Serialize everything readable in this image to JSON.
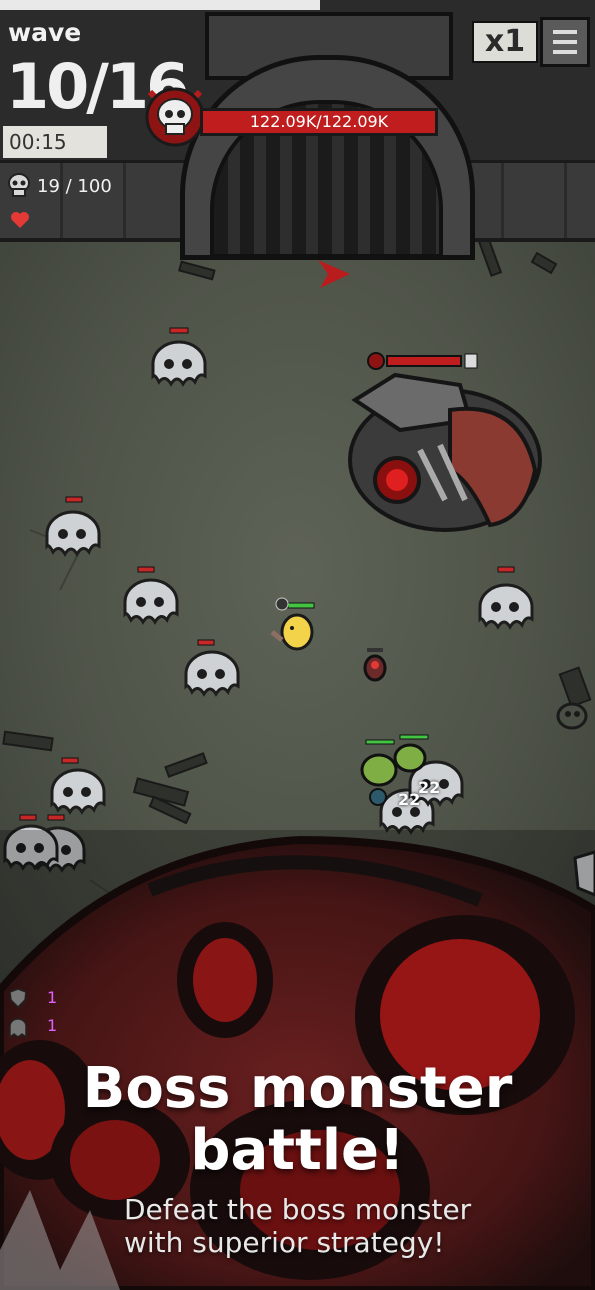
{
  "hud": {
    "wave_label": "wave",
    "wave_value": "10/16",
    "timer": "00:15",
    "kill_count": "19 / 100",
    "speed_label": "x1"
  },
  "boss": {
    "hp_text": "122.09K/122.09K",
    "hp_fraction": 1.0
  },
  "skills": [
    {
      "icon": "shield-icon",
      "count": "1"
    },
    {
      "icon": "ghost-icon",
      "count": "1"
    }
  ],
  "damage_numbers": [
    "22",
    "22"
  ],
  "promo": {
    "title_line1": "Boss monster",
    "title_line2": "battle!",
    "subtitle_line1": "Defeat the boss monster",
    "subtitle_line2": "with superior strategy!"
  },
  "colors": {
    "boss_red": "#c01e1e",
    "floor": "#4f5449",
    "skill_count": "#e060ff"
  }
}
